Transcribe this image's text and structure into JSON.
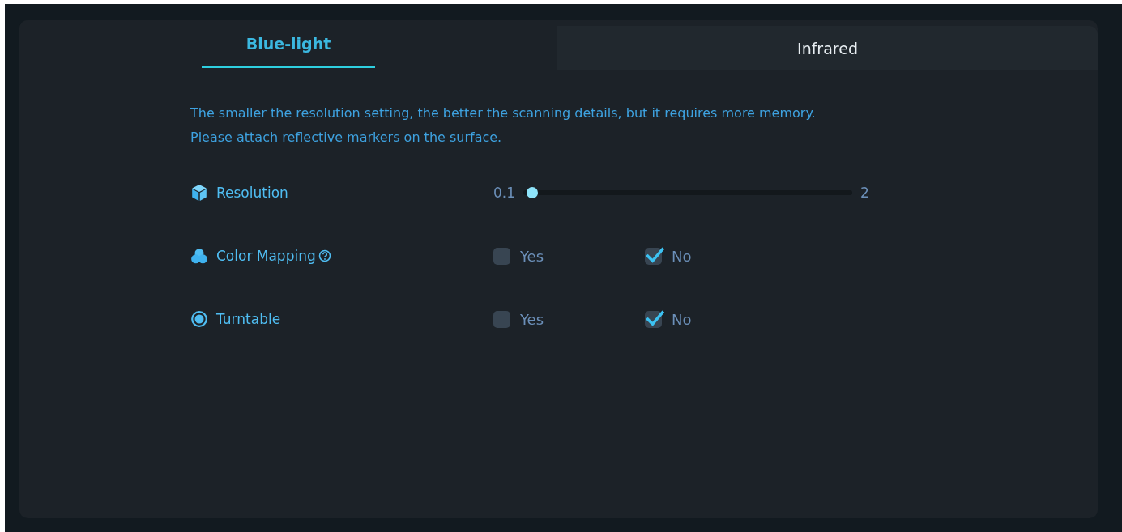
{
  "tabs": [
    {
      "label": "Blue-light",
      "selected": true
    },
    {
      "label": "Infrared",
      "selected": false
    }
  ],
  "notes": [
    "The smaller the resolution setting, the better the scanning details, but it requires more memory.",
    "Please attach reflective markers on the surface."
  ],
  "settings": [
    {
      "kind": "slider",
      "label": "Resolution",
      "min_label": "0.1",
      "max_label": "2",
      "level": 0.02
    },
    {
      "kind": "choice",
      "label": "Color Mapping",
      "help": true,
      "options": [
        {
          "label": "Yes",
          "checked": false
        },
        {
          "label": "No",
          "checked": true
        }
      ]
    },
    {
      "kind": "choice",
      "label": "Turntable",
      "help": false,
      "options": [
        {
          "label": "Yes",
          "checked": false
        },
        {
          "label": "No",
          "checked": true
        }
      ]
    }
  ]
}
